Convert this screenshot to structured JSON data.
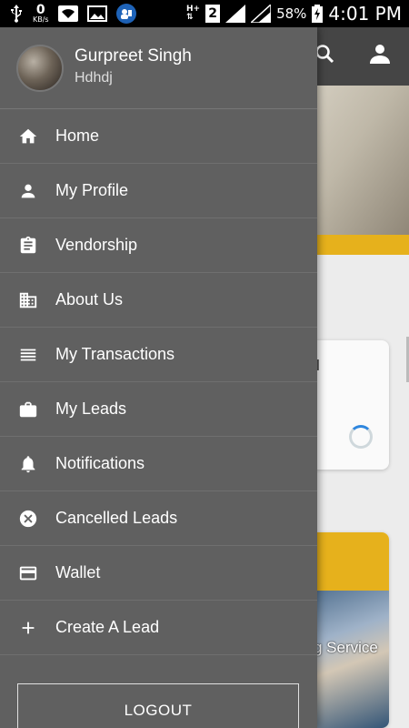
{
  "status_bar": {
    "data_speed_value": "0",
    "data_speed_unit": "KB/s",
    "network_label": "H+",
    "sim_slot": "2",
    "battery": "58%",
    "time": "4:01 PM"
  },
  "background": {
    "card_text": "tial",
    "card2_text": "g Service"
  },
  "drawer": {
    "user_name": "Gurpreet Singh",
    "user_sub": "Hdhdj",
    "items": [
      {
        "label": "Home",
        "icon": "home-icon"
      },
      {
        "label": "My Profile",
        "icon": "person-icon"
      },
      {
        "label": "Vendorship",
        "icon": "clipboard-icon"
      },
      {
        "label": "About Us",
        "icon": "business-icon"
      },
      {
        "label": "My Transactions",
        "icon": "list-icon"
      },
      {
        "label": "My Leads",
        "icon": "briefcase-icon"
      },
      {
        "label": "Notifications",
        "icon": "bell-icon"
      },
      {
        "label": "Cancelled Leads",
        "icon": "cancel-icon"
      },
      {
        "label": "Wallet",
        "icon": "credit-card-icon"
      },
      {
        "label": "Create A Lead",
        "icon": "plus-icon"
      }
    ],
    "logout_label": "LOGOUT"
  }
}
